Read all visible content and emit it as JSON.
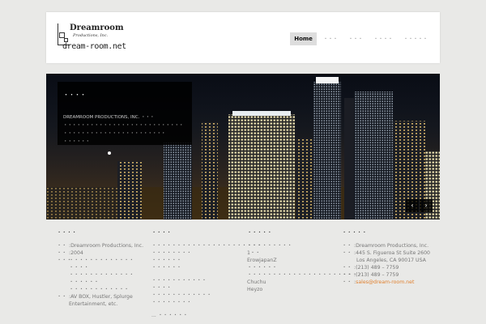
{
  "header": {
    "logo": {
      "title": "Dreamroom",
      "subtitle": "Productions, Inc.",
      "url": "dream-room.net"
    },
    "nav": [
      {
        "label": "Home",
        "active": true
      },
      {
        "label": "・・・",
        "active": false
      },
      {
        "label": "・・・",
        "active": false
      },
      {
        "label": "・・・・",
        "active": false
      },
      {
        "label": "・・・・・",
        "active": false
      }
    ]
  },
  "hero": {
    "overlay_title": "・・・・",
    "overlay_lines": [
      "DREAMROOM PRODUCTIONS, INC. ・・・",
      "・・・・・・・・・・・・・・・・・・・・・・・・・・・",
      "・・・・・・・・・・・・・・・・・・・・・・・",
      "・・・・・・"
    ],
    "prev_icon": "‹",
    "next_icon": "›"
  },
  "footer": {
    "company": {
      "title": "・・・・",
      "rows": [
        {
          "label": "・・",
          "value": ":Dreamroom Productions, Inc."
        },
        {
          "label": "・・",
          "value": ":2004"
        },
        {
          "label": "・・・",
          "value": "・・・・・・・・・・・・・"
        },
        {
          "label": "",
          "value": "・・・・"
        },
        {
          "label": "",
          "value": "・・・・・・・・・・・・・"
        },
        {
          "label": "",
          "value": "・・・・・・"
        },
        {
          "label": "",
          "value": "・・・・・・・・・・・・"
        },
        {
          "label": "・・",
          "value": ":AV BOX, Hustler, Splurge"
        },
        {
          "label": "",
          "value": "Entertainment, etc."
        }
      ]
    },
    "business": {
      "title": "・・・・",
      "lines": [
        "・・・・・・・・・・・・・・・・・・・・・・",
        "・・・・・・・・",
        "・・・・・・",
        "・・・・・・",
        "",
        "・・・・・・・・・・・",
        "・・・・",
        "・・・・・・・・・・・・",
        "・・・・・・・・",
        "",
        "... ・・・・・・"
      ]
    },
    "works": {
      "title": "・・・・・",
      "lines": [
        "・・・・・・・・・",
        "1・・",
        "ErowjapanZ",
        "・・・・・・",
        "・・・・・・・・・・・・・・・・・・・・・・・",
        "Chuchu",
        "Heyzo"
      ]
    },
    "contact": {
      "title": "・・・・・",
      "rows": [
        {
          "label": "・・",
          "value": ":Dreamroom Productions, Inc."
        },
        {
          "label": "・・",
          "value": ":445 S. Figueroa St Suite 2600"
        },
        {
          "label": "",
          "value": "Los Angeles, CA 90017 USA"
        },
        {
          "label": "・・",
          "value": ":(213) 489 – 7759"
        },
        {
          "label": "・・",
          "value": ":(213) 489 – 7759"
        },
        {
          "label": "・・",
          "value": ":",
          "link": "sales@dream-room.net"
        }
      ]
    }
  }
}
